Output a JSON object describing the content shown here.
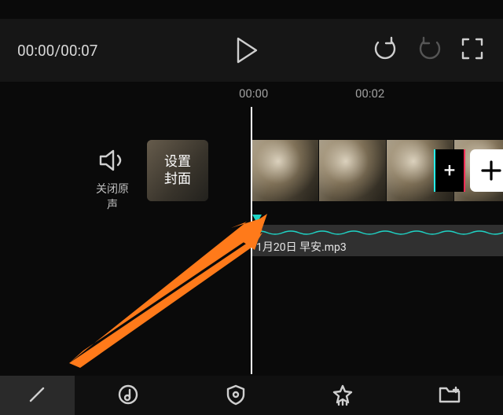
{
  "time": {
    "current": "00:00",
    "total": "00:07",
    "display": "00:00/00:07"
  },
  "ruler": {
    "t0": "00:00",
    "t1": "00:02"
  },
  "muteOriginal": {
    "label": "关闭原声"
  },
  "cover": {
    "label": "设置\n封面"
  },
  "audio": {
    "filename": "月20日 早安.mp3",
    "filename_prefix_cut": "1"
  },
  "add": {
    "plus": "+"
  },
  "colors": {
    "accentTeal": "#1fd4c6",
    "arrow": "#ff7a1a"
  }
}
